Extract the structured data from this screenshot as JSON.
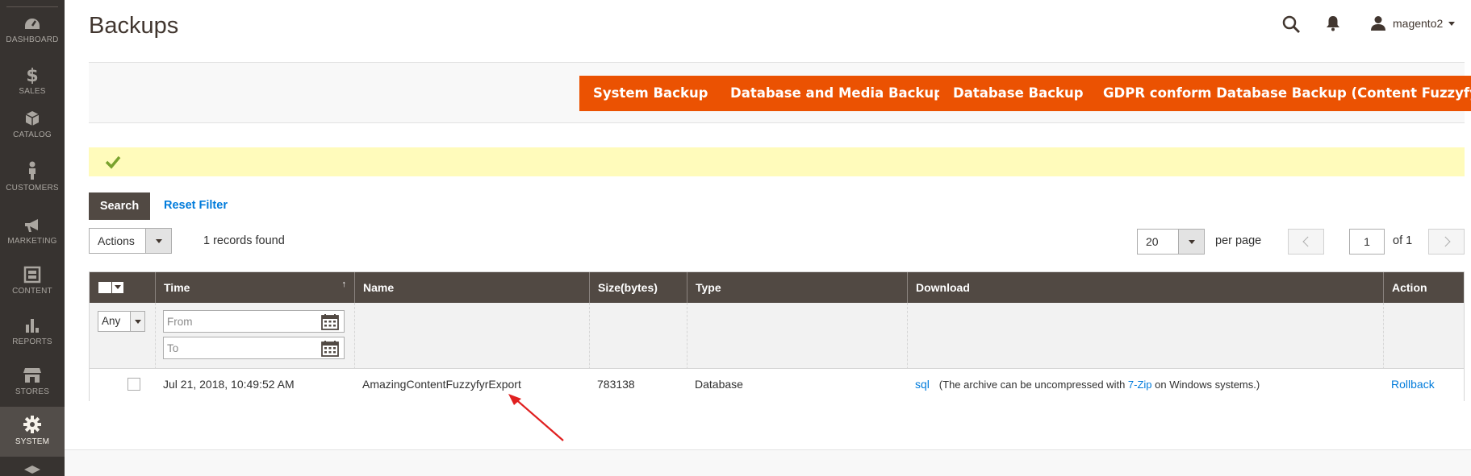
{
  "sidebar": {
    "items": [
      {
        "label": "DASHBOARD",
        "icon": "dashboard-icon"
      },
      {
        "label": "SALES",
        "icon": "dollar-icon"
      },
      {
        "label": "CATALOG",
        "icon": "box-icon"
      },
      {
        "label": "CUSTOMERS",
        "icon": "person-icon"
      },
      {
        "label": "MARKETING",
        "icon": "megaphone-icon"
      },
      {
        "label": "CONTENT",
        "icon": "layout-icon"
      },
      {
        "label": "REPORTS",
        "icon": "bar-chart-icon"
      },
      {
        "label": "STORES",
        "icon": "store-icon"
      },
      {
        "label": "SYSTEM",
        "icon": "gear-icon",
        "active": true
      }
    ]
  },
  "header": {
    "title": "Backups",
    "user": "magento2"
  },
  "actions": {
    "system_backup": "System Backup",
    "db_media_backup": "Database and Media Backup",
    "db_backup": "Database Backup",
    "gdpr_backup": "GDPR conform Database Backup (Content Fuzzyfyr)"
  },
  "filters": {
    "search_label": "Search",
    "reset_label": "Reset Filter",
    "mass_action": "Actions",
    "records_found": "1 records found",
    "per_page_value": "20",
    "per_page_label": "per page",
    "page_value": "1",
    "page_of": "of 1"
  },
  "grid": {
    "columns": {
      "time": "Time",
      "name": "Name",
      "size": "Size(bytes)",
      "type": "Type",
      "download": "Download",
      "action": "Action"
    },
    "sort_indicator": "↑",
    "filter_any": "Any",
    "filter_from_placeholder": "From",
    "filter_to_placeholder": "To",
    "rows": [
      {
        "time": "Jul 21, 2018, 10:49:52 AM",
        "name": "AmazingContentFuzzyfyrExport",
        "size": "783138",
        "type": "Database",
        "download_link": "sql",
        "download_note_before": "(The archive can be uncompressed with ",
        "download_note_link": "7-Zip",
        "download_note_after": " on Windows systems.)",
        "action": "Rollback"
      }
    ]
  },
  "colors": {
    "sidebar_bg": "#373330",
    "accent": "#eb5202",
    "grid_header": "#514943",
    "link": "#007bdb",
    "message_bg": "#fffbbb"
  }
}
